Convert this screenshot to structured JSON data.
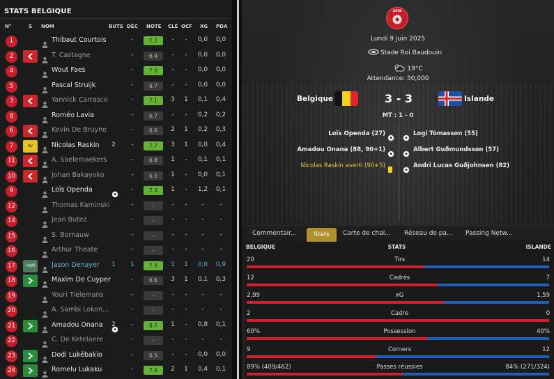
{
  "left_panel": {
    "title": "STATS BELGIQUE",
    "headers": {
      "num": "N°",
      "sub": "S",
      "name": "NOM",
      "goals": "BUTS",
      "dec": "DÉC",
      "rating": "NOTE",
      "key": "CLÉ",
      "ocf": "OCF",
      "xg": "XG",
      "pda": "PDA"
    },
    "players": [
      {
        "num": "1",
        "sub": "",
        "name": "Thibaut Courtois",
        "goal_icon": false,
        "goals": "",
        "dec": "-",
        "rating": "7.2",
        "good": true,
        "key": "-",
        "ocf": "-",
        "xg": "0,0",
        "pda": "0,0",
        "dim": false
      },
      {
        "num": "2",
        "sub": "out",
        "name": "T. Castagne",
        "goal_icon": false,
        "goals": "",
        "dec": "-",
        "rating": "6.4",
        "good": false,
        "key": "-",
        "ocf": "-",
        "xg": "0,0",
        "pda": "0,0",
        "dim": true
      },
      {
        "num": "4",
        "sub": "",
        "name": "Wout Faes",
        "goal_icon": false,
        "goals": "",
        "dec": "-",
        "rating": "7.0",
        "good": true,
        "key": "-",
        "ocf": "-",
        "xg": "0,0",
        "pda": "0,0",
        "dim": false
      },
      {
        "num": "5",
        "sub": "",
        "name": "Pascal Struijk",
        "goal_icon": false,
        "goals": "",
        "dec": "-",
        "rating": "6.7",
        "good": false,
        "key": "-",
        "ocf": "-",
        "xg": "0,0",
        "pda": "0,0",
        "dim": false
      },
      {
        "num": "3",
        "sub": "out",
        "name": "Yannick Carrasco",
        "goal_icon": false,
        "goals": "",
        "dec": "-",
        "rating": "7.1",
        "good": true,
        "key": "3",
        "ocf": "1",
        "xg": "0,1",
        "pda": "0,4",
        "dim": true
      },
      {
        "num": "8",
        "sub": "",
        "name": "Roméo Lavia",
        "goal_icon": false,
        "goals": "",
        "dec": "-",
        "rating": "6.7",
        "good": false,
        "key": "-",
        "ocf": "-",
        "xg": "0,2",
        "pda": "0,2",
        "dim": false
      },
      {
        "num": "6",
        "sub": "out",
        "name": "Kevin De Bruyne",
        "goal_icon": false,
        "goals": "",
        "dec": "-",
        "rating": "6.6",
        "good": false,
        "key": "2",
        "ocf": "1",
        "xg": "0,2",
        "pda": "0,3",
        "dim": true
      },
      {
        "num": "7",
        "sub": "av",
        "name": "Nicolas Raskin",
        "goal_icon": false,
        "goals": "2",
        "dec": "-",
        "rating": "7.7",
        "good": true,
        "key": "3",
        "ocf": "1",
        "xg": "0,0",
        "pda": "0,4",
        "dim": false
      },
      {
        "num": "11",
        "sub": "out",
        "name": "A. Saelemaekers",
        "goal_icon": false,
        "goals": "",
        "dec": "-",
        "rating": "6.8",
        "good": false,
        "key": "1",
        "ocf": "-",
        "xg": "0,1",
        "pda": "0,1",
        "dim": true
      },
      {
        "num": "10",
        "sub": "out",
        "name": "Johan Bakayoko",
        "goal_icon": false,
        "goals": "",
        "dec": "-",
        "rating": "6.5",
        "good": false,
        "key": "1",
        "ocf": "-",
        "xg": "0,0",
        "pda": "0,1",
        "dim": true
      },
      {
        "num": "9",
        "sub": "",
        "name": "Loïs Openda",
        "goal_icon": true,
        "goals": "",
        "dec": "-",
        "rating": "7.3",
        "good": true,
        "key": "1",
        "ocf": "-",
        "xg": "1,2",
        "pda": "0,1",
        "dim": false
      },
      {
        "num": "12",
        "sub": "",
        "name": "Thomas Kaminski",
        "goal_icon": false,
        "goals": "",
        "dec": "-",
        "rating": "-",
        "good": false,
        "key": "-",
        "ocf": "-",
        "xg": "-",
        "pda": "-",
        "dim": true
      },
      {
        "num": "14",
        "sub": "",
        "name": "Jean Butez",
        "goal_icon": false,
        "goals": "",
        "dec": "-",
        "rating": "-",
        "good": false,
        "key": "-",
        "ocf": "-",
        "xg": "-",
        "pda": "-",
        "dim": true
      },
      {
        "num": "15",
        "sub": "",
        "name": "S. Bornauw",
        "goal_icon": false,
        "goals": "",
        "dec": "-",
        "rating": "-",
        "good": false,
        "key": "-",
        "ocf": "-",
        "xg": "-",
        "pda": "-",
        "dim": true
      },
      {
        "num": "16",
        "sub": "",
        "name": "Arthur Theate",
        "goal_icon": false,
        "goals": "",
        "dec": "-",
        "rating": "-",
        "good": false,
        "key": "-",
        "ocf": "-",
        "xg": "-",
        "pda": "-",
        "dim": true
      },
      {
        "num": "17",
        "sub": "hdm",
        "name": "Jason Denayer",
        "goal_icon": false,
        "goals": "1",
        "dec": "1",
        "rating": "7.9",
        "good": true,
        "key": "1",
        "ocf": "1",
        "xg": "0,0",
        "pda": "0,9",
        "dim": false,
        "highlight": true
      },
      {
        "num": "18",
        "sub": "in",
        "name": "Maxim De Cuyper",
        "goal_icon": false,
        "goals": "",
        "dec": "-",
        "rating": "6.6",
        "good": false,
        "key": "3",
        "ocf": "1",
        "xg": "0,1",
        "pda": "0,3",
        "dim": false
      },
      {
        "num": "19",
        "sub": "",
        "name": "Youri Tielemans",
        "goal_icon": false,
        "goals": "",
        "dec": "-",
        "rating": "-",
        "good": false,
        "key": "-",
        "ocf": "-",
        "xg": "-",
        "pda": "-",
        "dim": true
      },
      {
        "num": "20",
        "sub": "",
        "name": "A. Sambi Lokon...",
        "goal_icon": false,
        "goals": "",
        "dec": "-",
        "rating": "-",
        "good": false,
        "key": "-",
        "ocf": "-",
        "xg": "-",
        "pda": "-",
        "dim": true
      },
      {
        "num": "21",
        "sub": "in",
        "name": "Amadou Onana",
        "goal_icon": true,
        "goals": "2",
        "dec": "-",
        "rating": "8.7",
        "good": true,
        "key": "1",
        "ocf": "-",
        "xg": "0,8",
        "pda": "0,1",
        "dim": false
      },
      {
        "num": "22",
        "sub": "",
        "name": "C. De Ketelaere",
        "goal_icon": false,
        "goals": "",
        "dec": "-",
        "rating": "-",
        "good": false,
        "key": "-",
        "ocf": "-",
        "xg": "-",
        "pda": "-",
        "dim": true
      },
      {
        "num": "23",
        "sub": "in",
        "name": "Dodi Lukébakio",
        "goal_icon": false,
        "goals": "",
        "dec": "-",
        "rating": "6.5",
        "good": false,
        "key": "-",
        "ocf": "-",
        "xg": "0,0",
        "pda": "0,0",
        "dim": false
      },
      {
        "num": "24",
        "sub": "in",
        "name": "Romelu Lukaku",
        "goal_icon": false,
        "goals": "",
        "dec": "-",
        "rating": "7.0",
        "good": true,
        "key": "2",
        "ocf": "1",
        "xg": "0,4",
        "pda": "0,1",
        "dim": false
      }
    ],
    "sub_labels": {
      "av": "Av",
      "hdm": "HdM"
    }
  },
  "match": {
    "competition_logo_text": "UEFA",
    "date": "Lundi 9 juin 2025",
    "stadium": "Stade Roi Baudouin",
    "temperature": "19°C",
    "attendance": "Attendance: 50,000",
    "home_team": "Belgique",
    "away_team": "Islande",
    "score": "3 - 3",
    "half_time": "MT : 1 - 0",
    "home_events": [
      {
        "text": "Loïs Openda (27)",
        "type": "goal"
      },
      {
        "text": "Amadou Onana (88, 90+1)",
        "type": "goal"
      },
      {
        "text": "Nicolas Raskin averti (90+5)",
        "type": "yellow"
      }
    ],
    "away_events": [
      {
        "text": "Logi Tómasson (55)",
        "type": "goal"
      },
      {
        "text": "Albert Guðmundsson (57)",
        "type": "goal"
      },
      {
        "text": "Andri Lucas Guðjohnsen (82)",
        "type": "goal"
      }
    ]
  },
  "tabs": [
    "Commentair...",
    "Stats",
    "Carte de chal...",
    "Réseau de pa...",
    "Passing Netw..."
  ],
  "active_tab": 1,
  "stats": {
    "home_label": "BELGIQUE",
    "center_label": "STATS",
    "away_label": "ISLANDE",
    "rows": [
      {
        "label": "Tirs",
        "home": "20",
        "away": "14",
        "home_share": 0.588
      },
      {
        "label": "Cadrés",
        "home": "12",
        "away": "7",
        "home_share": 0.632
      },
      {
        "label": "xG",
        "home": "2,99",
        "away": "1,59",
        "home_share": 0.653
      },
      {
        "label": "Cadre",
        "home": "2",
        "away": "0",
        "home_share": 1.0
      },
      {
        "label": "Possession",
        "home": "60%",
        "away": "40%",
        "home_share": 0.6
      },
      {
        "label": "Corners",
        "home": "9",
        "away": "12",
        "home_share": 0.429
      },
      {
        "label": "Passes réussies",
        "home": "89% (409/462)",
        "away": "84% (271/324)",
        "home_share": 0.515
      }
    ]
  },
  "colors": {
    "home_bar": "#cf2130",
    "away_bar": "#1f5fb5",
    "active_tab": "#b08f2c",
    "number_badge": "#c8202a",
    "good_rating": "#64b238"
  }
}
